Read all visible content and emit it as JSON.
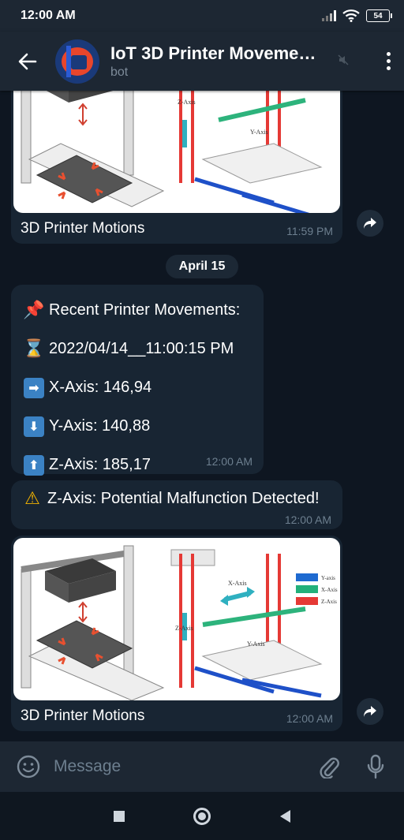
{
  "status_bar": {
    "time": "12:00 AM",
    "battery": "54"
  },
  "header": {
    "title": "IoT 3D Printer Moveme…",
    "subtitle": "bot"
  },
  "messages": {
    "photo1": {
      "caption": "3D Printer Motions",
      "time": "11:59 PM"
    },
    "date_separator": "April 15",
    "movements": {
      "header": "Recent Printer Movements:",
      "timestamp": "2022/04/14__11:00:15 PM",
      "x_axis": "X-Axis: 146,94",
      "y_axis": "Y-Axis: 140,88",
      "z_axis": "Z-Axis: 185,17",
      "time": "12:00 AM"
    },
    "alert": {
      "text": "Z-Axis: Potential Malfunction Detected!",
      "time": "12:00 AM"
    },
    "photo2": {
      "caption": "3D Printer Motions",
      "time": "12:00 AM"
    }
  },
  "diagram_legend": {
    "x": "X-Axis",
    "y": "Y-Axis",
    "z": "Z-Axis",
    "y_small": "Y-axis",
    "x_small": "X-Axis",
    "z_small": "Z-Axis"
  },
  "input": {
    "placeholder": "Message"
  },
  "icons": {
    "back": "arrow-left-icon",
    "menu": "more-vertical-icon",
    "mute": "mute-icon",
    "share": "share-icon",
    "emoji": "emoji-icon",
    "attach": "paperclip-icon",
    "mic": "microphone-icon"
  },
  "colors": {
    "background": "#0e1621",
    "bubble": "#182533",
    "header": "#1d2733",
    "accent": "#3b82c4"
  }
}
